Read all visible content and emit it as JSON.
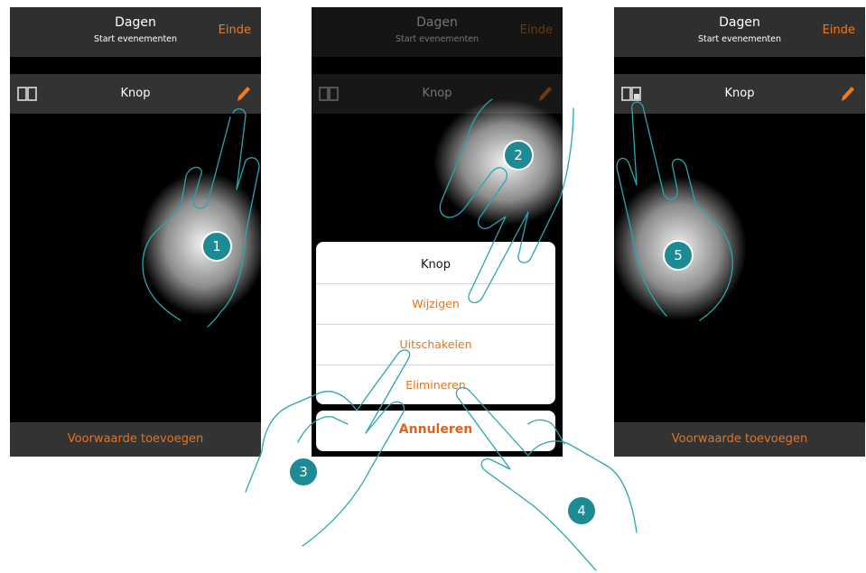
{
  "header": {
    "title": "Dagen",
    "subtitle": "Start evenementen",
    "end_label": "Einde"
  },
  "row": {
    "label": "Knop"
  },
  "footer": {
    "add_condition_label": "Voorwaarde toevoegen"
  },
  "action_sheet": {
    "title": "Knop",
    "items": [
      "Wijzigen",
      "Uitschakelen",
      "Elimineren"
    ],
    "cancel_label": "Annuleren"
  },
  "steps": [
    "1",
    "2",
    "3",
    "4",
    "5"
  ],
  "colors": {
    "accent": "#e5741f",
    "step_badge": "#1e8a94",
    "header_bg": "#2f2f2f",
    "row_bg": "#333333"
  },
  "icons": [
    "panels-icon",
    "pencil-icon",
    "panels-lock-icon",
    "hand-pointer-icon"
  ]
}
